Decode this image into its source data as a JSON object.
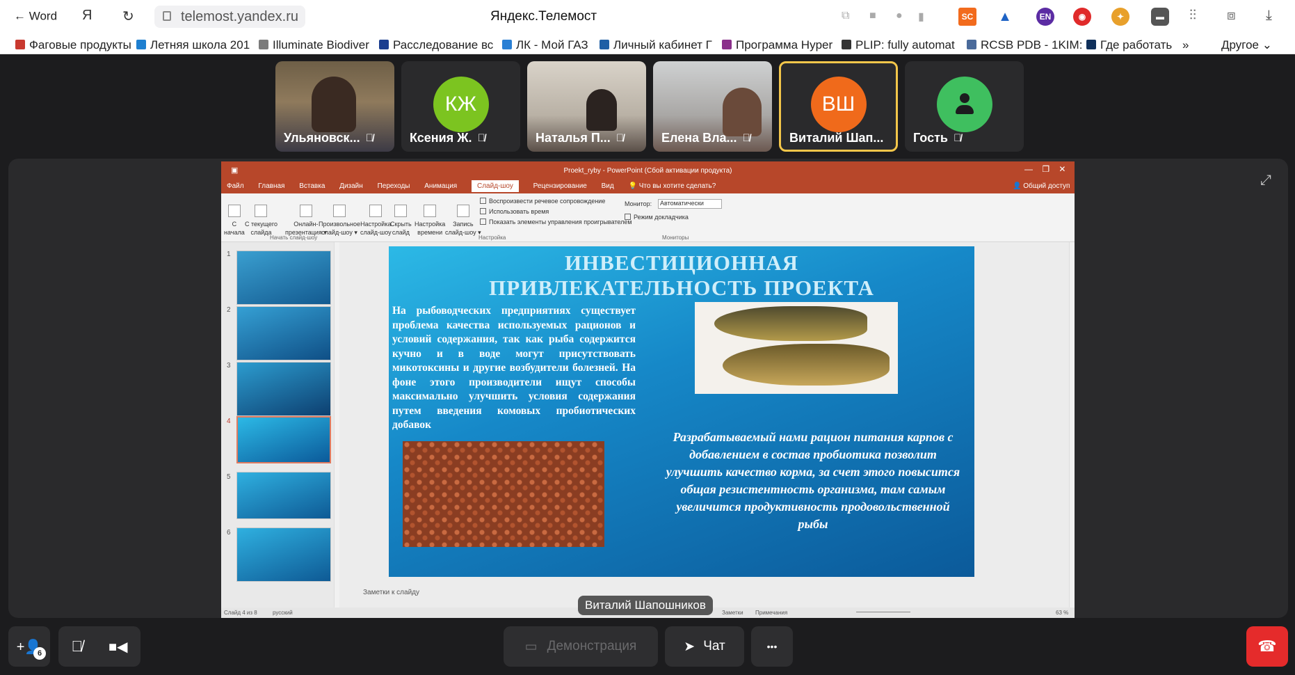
{
  "browser": {
    "back_label": "Word",
    "url": "telemost.yandex.ru",
    "page_title": "Яндекс.Телемост",
    "yandex_icon": "Я",
    "ext_sc": "SC",
    "ext_en": "EN"
  },
  "bookmarks": [
    {
      "label": "Фаговые продукты",
      "color": "#c9392f"
    },
    {
      "label": "Летняя школа 201",
      "color": "#1e7fd0"
    },
    {
      "label": "Illuminate Biodiver",
      "color": "#7b7b7b"
    },
    {
      "label": "Расследование вс",
      "color": "#1a3d8f"
    },
    {
      "label": "ЛК - Мой ГАЗ",
      "color": "#2a7fd4"
    },
    {
      "label": "Личный кабинет Г",
      "color": "#1f5fa5"
    },
    {
      "label": "Программа Hyper",
      "color": "#8a2f8a"
    },
    {
      "label": "PLIP: fully automat",
      "color": "#333333"
    },
    {
      "label": "RCSB PDB - 1KIM:",
      "color": "#4a6a9a"
    },
    {
      "label": "Где работать",
      "color": "#10305a"
    }
  ],
  "bookmarks_more": "»",
  "bookmarks_other": "Другое",
  "participants": [
    {
      "name": "Ульяновск...",
      "type": "video"
    },
    {
      "name": "Ксения Ж.",
      "type": "avatar",
      "initials": "КЖ",
      "color": "#7cc420"
    },
    {
      "name": "Наталья П...",
      "type": "video"
    },
    {
      "name": "Елена Вла...",
      "type": "video"
    },
    {
      "name": "Виталий Шап...",
      "type": "avatar",
      "initials": "ВШ",
      "color": "#f06a1b",
      "active": true
    },
    {
      "name": "Гость",
      "type": "avatar",
      "initials": "",
      "color": "#3fbf5f"
    }
  ],
  "ppt": {
    "window_title": "Proekt_ryby - PowerPoint (Сбой активации продукта)",
    "tabs": [
      "Файл",
      "Главная",
      "Вставка",
      "Дизайн",
      "Переходы",
      "Анимация",
      "Слайд-шоу",
      "Рецензирование",
      "Вид"
    ],
    "active_tab": "Слайд-шоу",
    "tell_me": "Что вы хотите сделать?",
    "share": "Общий доступ",
    "ribbon_buttons": [
      {
        "line1": "С",
        "line2": "начала"
      },
      {
        "line1": "С текущего",
        "line2": "слайда"
      },
      {
        "line1": "Онлайн-",
        "line2": "презентация ▾"
      },
      {
        "line1": "Произвольное",
        "line2": "слайд-шоу ▾"
      },
      {
        "line1": "Настройка",
        "line2": "слайд-шоу"
      },
      {
        "line1": "Скрыть",
        "line2": "слайд"
      },
      {
        "line1": "Настройка",
        "line2": "времени"
      },
      {
        "line1": "Запись",
        "line2": "слайд-шоу ▾"
      }
    ],
    "checkboxes": [
      "Воспроизвести речевое сопровождение",
      "Использовать время",
      "Показать элементы управления проигрывателем"
    ],
    "monitor_label": "Монитор:",
    "monitor_value": "Автоматически",
    "presenter_mode": "Режим докладчика",
    "group_start": "Начать слайд-шоу",
    "group_settings": "Настройка",
    "group_monitors": "Мониторы",
    "slide_numbers": [
      "1",
      "2",
      "3",
      "4",
      "5",
      "6"
    ],
    "notes_placeholder": "Заметки к слайду",
    "status_slide": "Слайд 4 из 8",
    "status_lang": "русский",
    "status_notes": "Заметки",
    "status_comments": "Примечания",
    "zoom": "63 %"
  },
  "slide": {
    "title_line1": "ИНВЕСТИЦИОННАЯ",
    "title_line2": "ПРИВЛЕКАТЕЛЬНОСТЬ ПРОЕКТА",
    "body": "На рыбоводческих предприятиях существует проблема качества используемых рационов и условий содержания, так как рыба содержится кучно и в воде могут присутствовать микотоксины и другие возбудители болезней. На фоне этого производители ищут способы максимально улучшить условия содержания путем введения комовых пробиотических добавок",
    "italic": "Разрабатываемый нами рацион питания карпов с добавлением в состав пробиотика позволит улучшить качество корма, за счет этого повысится общая резистентность организма, там самым увеличится продуктивность продовольственной рыбы"
  },
  "presenter_label": "Виталий Шапошников",
  "toolbar": {
    "invite_count": "6",
    "demo_label": "Демонстрация",
    "chat_label": "Чат",
    "more_label": "•••"
  }
}
